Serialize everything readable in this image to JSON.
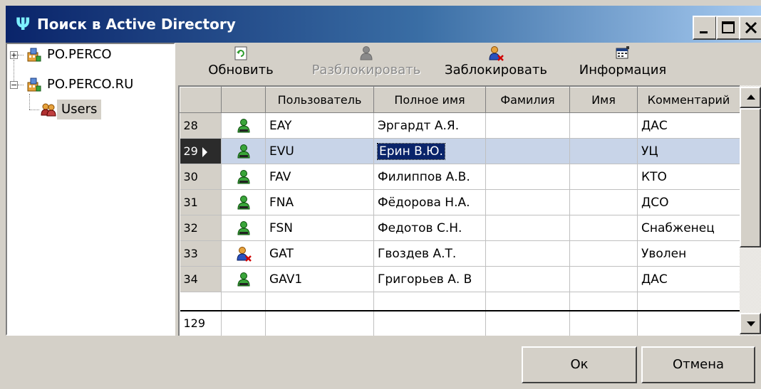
{
  "window": {
    "title": "Поиск в Active Directory"
  },
  "tree": {
    "items": [
      {
        "label": "PO.PERCO",
        "expander": "+"
      },
      {
        "label": "PO.PERCO.RU",
        "expander": "−"
      },
      {
        "label": "Users"
      }
    ]
  },
  "toolbar": {
    "refresh": "Обновить",
    "unblock": "Разблокировать",
    "block": "Заблокировать",
    "info": "Информация"
  },
  "table": {
    "columns": [
      "Пользователь",
      "Полное имя",
      "Фамилия",
      "Имя",
      "Комментарий"
    ],
    "rows": [
      {
        "n": "28",
        "user": "EAY",
        "full": "Эргардт А.Я.",
        "last": "",
        "first": "",
        "comment": "ДАС",
        "icon": "user-active-icon"
      },
      {
        "n": "29",
        "user": "EVU",
        "full": "Ерин В.Ю.",
        "last": "",
        "first": "",
        "comment": "УЦ",
        "icon": "user-active-icon"
      },
      {
        "n": "30",
        "user": "FAV",
        "full": "Филиппов А.В.",
        "last": "",
        "first": "",
        "comment": "КТО",
        "icon": "user-active-icon"
      },
      {
        "n": "31",
        "user": "FNA",
        "full": "Фёдорова Н.А.",
        "last": "",
        "first": "",
        "comment": "ДСО",
        "icon": "user-active-icon"
      },
      {
        "n": "32",
        "user": "FSN",
        "full": "Федотов С.Н.",
        "last": "",
        "first": "",
        "comment": "Снабженец",
        "icon": "user-active-icon"
      },
      {
        "n": "33",
        "user": "GAT",
        "full": "Гвоздев А.Т.",
        "last": "",
        "first": "",
        "comment": "Уволен",
        "icon": "user-blocked-icon"
      },
      {
        "n": "34",
        "user": "GAV1",
        "full": "Григорьев А. В",
        "last": "",
        "first": "",
        "comment": "ДАС",
        "icon": "user-active-icon"
      }
    ],
    "selected_row": "29",
    "footer_count": "129"
  },
  "buttons": {
    "ok": "Ок",
    "cancel": "Отмена"
  },
  "colors": {
    "titlebar_start": "#0a246a",
    "titlebar_end": "#a6caf0",
    "selection": "#0a246a",
    "row_selected": "#c8d4e8"
  }
}
